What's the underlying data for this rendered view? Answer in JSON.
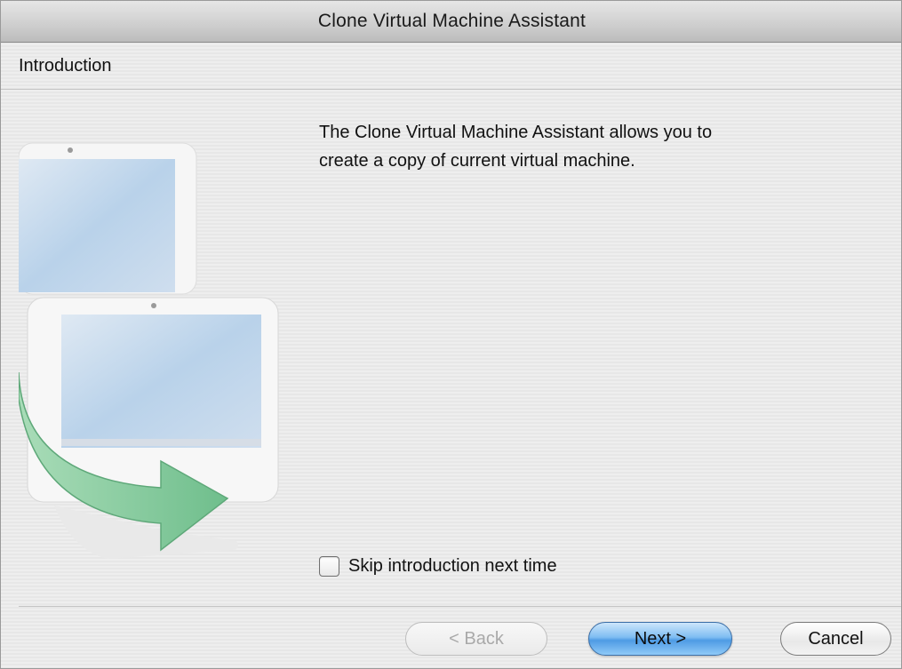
{
  "window": {
    "title": "Clone Virtual Machine Assistant"
  },
  "section": {
    "title": "Introduction"
  },
  "content": {
    "line1": "The Clone Virtual Machine Assistant allows you to",
    "line2": "create a copy of current virtual machine.",
    "illustration_icon": "cloned-monitors-with-arrow"
  },
  "skip_intro": {
    "label": "Skip introduction next time",
    "checked": false
  },
  "buttons": {
    "back": "< Back",
    "next": "Next >",
    "cancel": "Cancel"
  },
  "colors": {
    "default_button": "#6aaeef",
    "arrow": "#7fc59a",
    "screen": "#b9d2ea"
  }
}
